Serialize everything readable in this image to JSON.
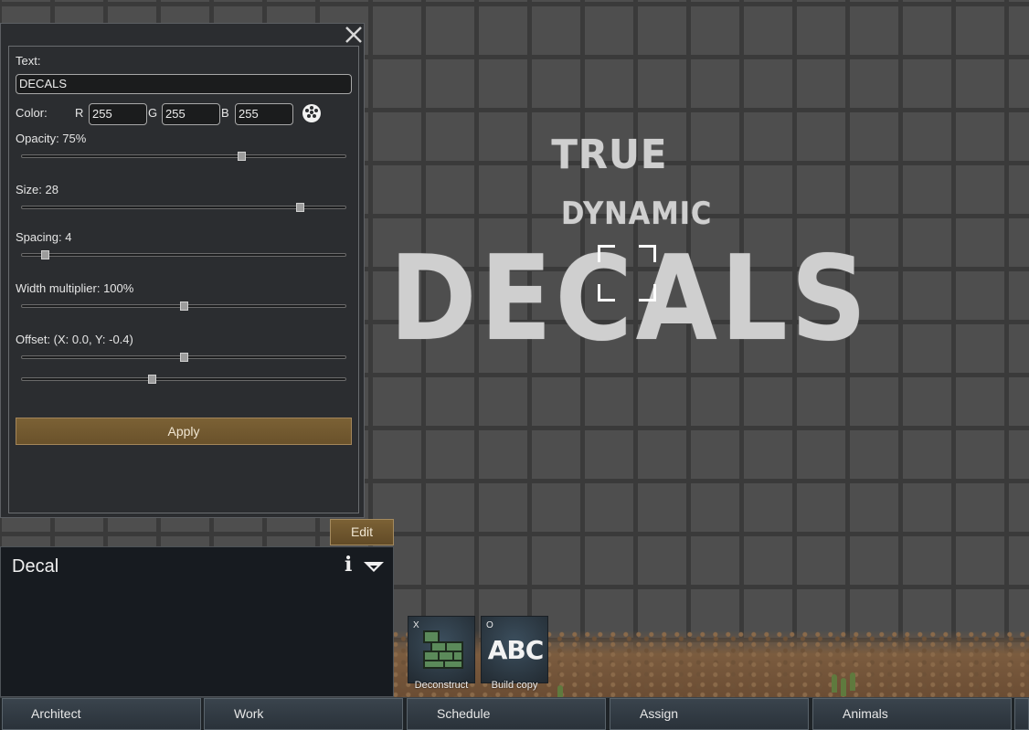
{
  "scene": {
    "decals": {
      "line1": "TRUE",
      "line2": "DYNAMIC",
      "main": "DECALS"
    }
  },
  "dialog": {
    "text_label": "Text:",
    "text_value": "DECALS",
    "color_label": "Color:",
    "r_label": "R",
    "g_label": "G",
    "b_label": "B",
    "r_value": "255",
    "g_value": "255",
    "b_value": "255",
    "opacity_label": "Opacity: 75%",
    "opacity_value": 0.685,
    "size_label": "Size: 28",
    "size_value": 0.87,
    "spacing_label": "Spacing: 4",
    "spacing_value": 0.06,
    "width_label": "Width multiplier: 100%",
    "width_value": 0.5,
    "offset_label": "Offset: (X: 0.0, Y: -0.4)",
    "offset_x_value": 0.5,
    "offset_y_value": 0.4,
    "apply_label": "Apply"
  },
  "edit_button": {
    "label": "Edit"
  },
  "inspect": {
    "title": "Decal"
  },
  "gizmos": [
    {
      "key": "X",
      "label": "Deconstruct",
      "icon": "deconstruct-icon"
    },
    {
      "key": "O",
      "label": "Build copy",
      "icon_text": "ABC"
    }
  ],
  "bottom_tabs": [
    "Architect",
    "Work",
    "Schedule",
    "Assign",
    "Animals"
  ],
  "colors": {
    "accent_button": "#7b6135",
    "panel_bg": "#2b2d30",
    "inspect_bg": "#171b20"
  }
}
